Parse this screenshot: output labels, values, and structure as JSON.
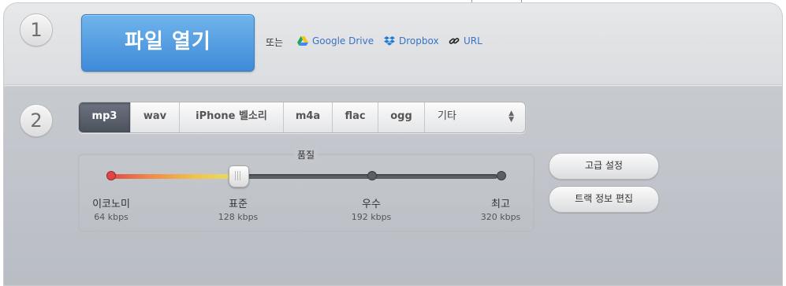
{
  "steps": {
    "step1": "1",
    "step2": "2"
  },
  "open": {
    "label": "파일 열기"
  },
  "sources": {
    "or_label": "또는",
    "google_drive": "Google Drive",
    "dropbox": "Dropbox",
    "url": "URL"
  },
  "formats": {
    "items": [
      "mp3",
      "wav",
      "iPhone 벨소리",
      "m4a",
      "flac",
      "ogg"
    ],
    "other": "기타",
    "selected": "mp3"
  },
  "quality": {
    "title": "품질",
    "selected_level": 1,
    "levels": [
      {
        "name": "이코노미",
        "rate": "64 kbps"
      },
      {
        "name": "표준",
        "rate": "128 kbps"
      },
      {
        "name": "우수",
        "rate": "192 kbps"
      },
      {
        "name": "최고",
        "rate": "320 kbps"
      }
    ]
  },
  "buttons": {
    "advanced": "고급 설정",
    "track_info": "트랙 정보 편집"
  },
  "colors": {
    "accent": "#4a90dd",
    "link": "#3a73c4",
    "active_tab": "#555b66"
  }
}
